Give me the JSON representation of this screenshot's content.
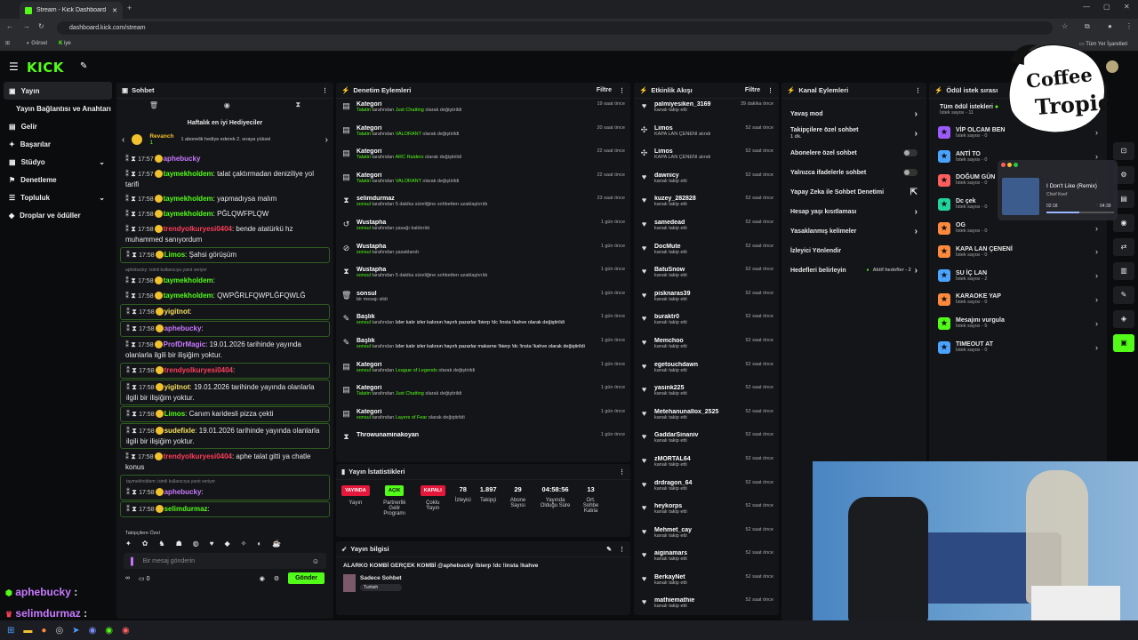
{
  "browser": {
    "tab_title": "Stream - Kick Dashboard",
    "url": "dashboard.kick.com/stream",
    "bookmarks": [
      "Görsel",
      "iye"
    ],
    "bookmarks_right": "Tüm Yer İşaretleri"
  },
  "nav": [
    {
      "label": "Yayın",
      "active": true,
      "icon": "▣"
    },
    {
      "label": "Yayın Bağlantısı ve Anahtarı",
      "sub": true
    },
    {
      "label": "Gelir",
      "icon": "▤"
    },
    {
      "label": "Başarılar",
      "icon": "✦"
    },
    {
      "label": "Stüdyo",
      "icon": "▦",
      "chev": true
    },
    {
      "label": "Denetleme",
      "icon": "⚑"
    },
    {
      "label": "Topluluk",
      "icon": "☰",
      "chev": true
    },
    {
      "label": "Droplar ve ödüller",
      "icon": "◆"
    }
  ],
  "chat": {
    "title": "Sohbet",
    "gift_title": "Haftalık en iyi Hediyeciler",
    "gift_user": "Revanch",
    "gift_count": "1",
    "gift_note": "1 abonelik hediye ederek 2. sıraya yüksel",
    "lines": [
      {
        "time": "17:57",
        "user": "aphebucky",
        "color": "#c879ff",
        "msg": "",
        "top": true
      },
      {
        "time": "17:57",
        "user": "taymekholdem",
        "color": "#53fc18",
        "msg": ": talat çaktırmadan deniziliye yol tarifi"
      },
      {
        "time": "17:58",
        "user": "taymekholdem",
        "color": "#53fc18",
        "msg": ": yapmadıysa malım"
      },
      {
        "time": "17:58",
        "user": "taymekholdem",
        "color": "#53fc18",
        "msg": ": PĞLQWFPLQW"
      },
      {
        "time": "17:58",
        "user": "trendyolkuryesi0404",
        "color": "#ff3d5a",
        "msg": ": bende atatürkü hz muhammed sanıyordum"
      },
      {
        "time": "17:58",
        "user": "Limos",
        "color": "#53fc18",
        "msg": ": Şahsi görüşüm",
        "hl": true
      },
      {
        "time": "17:58",
        "user": "taymekholdem",
        "color": "#53fc18",
        "msg": ":",
        "reply": "aphebucky: isimli kullanıcıya yanıt veriyor"
      },
      {
        "time": "17:58",
        "user": "taymekholdem",
        "color": "#53fc18",
        "msg": ": QWPĞRLFQWPLĞFQWLĞ"
      },
      {
        "time": "17:58",
        "user": "yigitnot",
        "color": "#f5e05e",
        "msg": ":",
        "hl": true
      },
      {
        "time": "17:58",
        "user": "aphebucky",
        "color": "#c879ff",
        "msg": ":",
        "hl": true
      },
      {
        "time": "17:58",
        "user": "ProfDrMagic",
        "color": "#c879ff",
        "msg": ": 19.01.2026 tarihinde yayında olanlarla ilgili bir ilişiğim yoktur."
      },
      {
        "time": "17:58",
        "user": "trendyolkuryesi0404",
        "color": "#ff3d5a",
        "msg": ":",
        "hl": true
      },
      {
        "time": "17:58",
        "user": "yigitnot",
        "color": "#f5e05e",
        "msg": ": 19.01.2026 tarihinde yayında olanlarla ilgili bir ilişiğim yoktur.",
        "hl": true
      },
      {
        "time": "17:58",
        "user": "Limos",
        "color": "#53fc18",
        "msg": ": Canım karidesli pizza çekti",
        "hl": true
      },
      {
        "time": "17:58",
        "user": "sudefixle",
        "color": "#f5e05e",
        "msg": ": 19.01.2026 tarihinde yayında olanlarla ilgili bir ilişiğim yoktur.",
        "hl": true
      },
      {
        "time": "17:58",
        "user": "trendyolkuryesi0404",
        "color": "#ff3d5a",
        "msg": ": aphe talat gitti ya chatle konus"
      },
      {
        "time": "17:58",
        "user": "aphebucky",
        "color": "#c879ff",
        "msg": ":",
        "reply": "taymekholdem: isimli kullanıcıya yanıt veriyor",
        "hl": true
      },
      {
        "time": "17:58",
        "user": "selimdurmaz",
        "color": "#53fc18",
        "msg": ":",
        "hl": true
      }
    ],
    "followers_only": "Takipçilere Özel",
    "input_placeholder": "Bir mesaj gönderin",
    "count": "0",
    "send": "Gönder"
  },
  "overlay_chat": [
    {
      "user": "aphebucky",
      "msg": ":"
    },
    {
      "user": "selimdurmaz",
      "msg": ":"
    }
  ],
  "moderation": {
    "title": "Denetim Eylemleri",
    "filter": "Filtre",
    "rows": [
      {
        "icon": "▤",
        "title": "Kategori",
        "desc_user": "Talatin",
        "desc_pre": " tarafından ",
        "desc_hl": "Just Chatting",
        "desc_post": " olarak değiştirildi",
        "time": "19 saat önce"
      },
      {
        "icon": "▤",
        "title": "Kategori",
        "desc_user": "Talatin",
        "desc_pre": " tarafından ",
        "desc_hl": "VALORANT",
        "desc_post": " olarak değiştirildi",
        "time": "20 saat önce"
      },
      {
        "icon": "▤",
        "title": "Kategori",
        "desc_user": "Talatin",
        "desc_pre": " tarafından ",
        "desc_hl": "ARC Raiders",
        "desc_post": " olarak değiştirildi",
        "time": "22 saat önce"
      },
      {
        "icon": "▤",
        "title": "Kategori",
        "desc_user": "Talatin",
        "desc_pre": " tarafından ",
        "desc_hl": "VALORANT",
        "desc_post": " olarak değiştirildi",
        "time": "22 saat önce"
      },
      {
        "icon": "⧗",
        "title": "selimdurmaz",
        "desc_user": "sonsul",
        "desc_pre": " tarafından 5 dakika süreliğine sohbetten uzaklaştırıldı",
        "desc_hl": "",
        "desc_post": "",
        "time": "23 saat önce"
      },
      {
        "icon": "↺",
        "title": "Wustapha",
        "desc_user": "sonsul",
        "desc_pre": " tarafından yasağı kaldırıldı",
        "desc_hl": "",
        "desc_post": "",
        "time": "1 gün önce"
      },
      {
        "icon": "⊘",
        "title": "Wustapha",
        "desc_user": "sonsul",
        "desc_pre": " tarafından yasaklandı",
        "desc_hl": "",
        "desc_post": "",
        "time": "1 gün önce"
      },
      {
        "icon": "⧗",
        "title": "Wustapha",
        "desc_user": "sonsul",
        "desc_pre": " tarafından 5 dakika süreliğine sohbetten uzaklaştırıldı",
        "desc_hl": "",
        "desc_post": "",
        "time": "1 gün önce"
      },
      {
        "icon": "🗑",
        "title": "sonsul",
        "desc_user": "",
        "desc_pre": "bir mesajı sildi",
        "desc_hl": "",
        "desc_post": "",
        "time": "1 gün önce"
      },
      {
        "icon": "✎",
        "title": "Başlık",
        "desc_user": "sonsul",
        "desc_pre": " tarafından ",
        "desc_hl": "",
        "desc_post": "İzler kalır izler kalırsın hayırlı pazarlar !bierp !dc !insta !kahve olarak değiştirildi",
        "time": "1 gün önce"
      },
      {
        "icon": "✎",
        "title": "Başlık",
        "desc_user": "sonsul",
        "desc_pre": " tarafından ",
        "desc_hl": "",
        "desc_post": "İzler kalır izler kalırsın hayırlı pazarlar makarne !bierp !dc !insta !kahve olarak değiştirildi",
        "time": "1 gün önce"
      },
      {
        "icon": "▤",
        "title": "Kategori",
        "desc_user": "sonsul",
        "desc_pre": " tarafından ",
        "desc_hl": "League of Legends",
        "desc_post": " olarak değiştirildi",
        "time": "1 gün önce"
      },
      {
        "icon": "▤",
        "title": "Kategori",
        "desc_user": "Talatin",
        "desc_pre": " tarafından ",
        "desc_hl": "Just Chatting",
        "desc_post": " olarak değiştirildi",
        "time": "1 gün önce"
      },
      {
        "icon": "▤",
        "title": "Kategori",
        "desc_user": "sonsul",
        "desc_pre": " tarafından ",
        "desc_hl": "Layers of Fear",
        "desc_post": " olarak değiştirildi",
        "time": "1 gün önce"
      },
      {
        "icon": "⧗",
        "title": "Throwunaminakoyan",
        "desc_user": "",
        "desc_pre": "",
        "desc_hl": "",
        "desc_post": "",
        "time": "1 gün önce"
      }
    ]
  },
  "stats": {
    "title": "Yayın İstatistikleri",
    "live": "YAYINDA",
    "partner": "AÇIK",
    "chat": "KAPALI",
    "viewers": "78",
    "followers": "1.897",
    "subs": "29",
    "uptime": "04:58:56",
    "extra": "13",
    "l_stream": "Yayın",
    "l_partner": "Partnerlik Gelir Programı",
    "l_multi": "Çoklu Yayın",
    "l_viewers": "İzleyici",
    "l_followers": "Takipçi",
    "l_subs": "Abone Sayısı",
    "l_uptime": "Yayında Olduğu Süre",
    "l_extra": "Ort. Sohbe Katıla"
  },
  "info": {
    "title": "Yayın bilgisi",
    "stream_title": "ALARKO KOMBİ GERÇEK KOMBİ @aphebucky !bierp !dc !insta !kahve",
    "category": "Sadece Sohbet",
    "tag": "Turkish"
  },
  "events": {
    "title": "Etkinlik Akışı",
    "filter": "Filtre",
    "rows": [
      {
        "icon": "♥",
        "user": "palmiyesiken_3169",
        "desc": "kanalı takip etti",
        "time": "39 dakika önce"
      },
      {
        "icon": "✣",
        "user": "Limos",
        "desc": "KAPA LAN ÇENENİ alındı",
        "time": "52 saat önce",
        "g": true
      },
      {
        "icon": "✣",
        "user": "Limos",
        "desc": "KAPA LAN ÇENENİ alındı",
        "time": "52 saat önce",
        "g": true
      },
      {
        "icon": "♥",
        "user": "dawnicy",
        "desc": "kanalı takip etti",
        "time": "52 saat önce"
      },
      {
        "icon": "♥",
        "user": "kuzey_282828",
        "desc": "kanalı takip etti",
        "time": "52 saat önce"
      },
      {
        "icon": "♥",
        "user": "samedead",
        "desc": "kanalı takip etti",
        "time": "52 saat önce"
      },
      {
        "icon": "♥",
        "user": "DocMute",
        "desc": "kanalı takip etti",
        "time": "52 saat önce"
      },
      {
        "icon": "♥",
        "user": "BatuSnow",
        "desc": "kanalı takip etti",
        "time": "52 saat önce"
      },
      {
        "icon": "♥",
        "user": "pisknaras39",
        "desc": "kanalı takip etti",
        "time": "52 saat önce"
      },
      {
        "icon": "♥",
        "user": "buraktr0",
        "desc": "kanalı takip etti",
        "time": "52 saat önce"
      },
      {
        "icon": "♥",
        "user": "Memchoo",
        "desc": "kanalı takip etti",
        "time": "52 saat önce"
      },
      {
        "icon": "♥",
        "user": "egetouchdawn",
        "desc": "kanalı takip etti",
        "time": "52 saat önce"
      },
      {
        "icon": "♥",
        "user": "yasink225",
        "desc": "kanalı takip etti",
        "time": "52 saat önce"
      },
      {
        "icon": "♥",
        "user": "Metehanunallox_2525",
        "desc": "kanalı takip etti",
        "time": "52 saat önce"
      },
      {
        "icon": "♥",
        "user": "GaddarSinaniv",
        "desc": "kanalı takip etti",
        "time": "52 saat önce"
      },
      {
        "icon": "♥",
        "user": "zMORTAL64",
        "desc": "kanalı takip etti",
        "time": "52 saat önce"
      },
      {
        "icon": "♥",
        "user": "drdragon_64",
        "desc": "kanalı takip etti",
        "time": "52 saat önce"
      },
      {
        "icon": "♥",
        "user": "heykorps",
        "desc": "kanalı takip etti",
        "time": "52 saat önce"
      },
      {
        "icon": "♥",
        "user": "Mehmet_cay",
        "desc": "kanalı takip etti",
        "time": "52 saat önce"
      },
      {
        "icon": "♥",
        "user": "aiginamars",
        "desc": "kanalı takip etti",
        "time": "52 saat önce"
      },
      {
        "icon": "♥",
        "user": "BerkayNet",
        "desc": "kanalı takip etti",
        "time": "52 saat önce"
      },
      {
        "icon": "♥",
        "user": "mathiemathie",
        "desc": "kanalı takip etti",
        "time": "52 saat önce"
      }
    ]
  },
  "channel": {
    "title": "Kanal Eylemleri",
    "rows": [
      {
        "label": "Yavaş mod",
        "kind": "chev"
      },
      {
        "label": "Takipçilere özel sohbet",
        "sub": "1 dk.",
        "kind": "chev"
      },
      {
        "label": "Abonelere özel sohbet",
        "kind": "toggle"
      },
      {
        "label": "Yalnızca ifadelerle sohbet",
        "kind": "toggle"
      },
      {
        "label": "Yapay Zeka ile Sohbet Denetimi",
        "kind": "ext"
      },
      {
        "label": "Hesap yaşı kısıtlaması",
        "kind": "chev"
      },
      {
        "label": "Yasaklanmış kelimeler",
        "kind": "chev"
      },
      {
        "label": "İzleyici Yönlendir",
        "kind": "none"
      },
      {
        "label": "Hedefleri belirleyin",
        "sub": "Aktif hedefler - 2",
        "kind": "chev"
      }
    ]
  },
  "rewards": {
    "title": "Ödül istek sırası",
    "all": "Tüm ödül istekleri",
    "all_sub": "İstek sayısı - 11",
    "rows": [
      {
        "name": "VİP OLCAM BEN",
        "sub": "İstek sayısı - 0",
        "color": "#9b5cff"
      },
      {
        "name": "ANTİ TO",
        "sub": "İstek sayısı - 0",
        "color": "#4aa3ff"
      },
      {
        "name": "DOĞUM GÜN",
        "sub": "İstek sayısı - 0",
        "color": "#ff5e5e"
      },
      {
        "name": "Dc çek",
        "sub": "İstek sayısı - 0",
        "color": "#22d39e"
      },
      {
        "name": "OG",
        "sub": "İstek sayısı - 0",
        "color": "#ff8a3d"
      },
      {
        "name": "KAPA LAN ÇENENİ",
        "sub": "İstek sayısı - 0",
        "color": "#ff8a3d"
      },
      {
        "name": "SU İÇ LAN",
        "sub": "İstek sayısı - 2",
        "color": "#4aa3ff"
      },
      {
        "name": "KARAOKE YAP",
        "sub": "İstek sayısı - 0",
        "color": "#ff8a3d"
      },
      {
        "name": "Mesajını vurgula",
        "sub": "İstek sayısı - 5",
        "color": "#53fc18"
      },
      {
        "name": "TIMEOUT AT",
        "sub": "İstek sayısı - 0",
        "color": "#4aa3ff"
      }
    ]
  },
  "logo": {
    "line1": "Coffee",
    "line2": "Tropic"
  },
  "music": {
    "song": "I Don't Like (Remix)",
    "artist": "Chief Keef",
    "elapsed": "02:18",
    "total": "04:39",
    "progress": 0.49
  }
}
